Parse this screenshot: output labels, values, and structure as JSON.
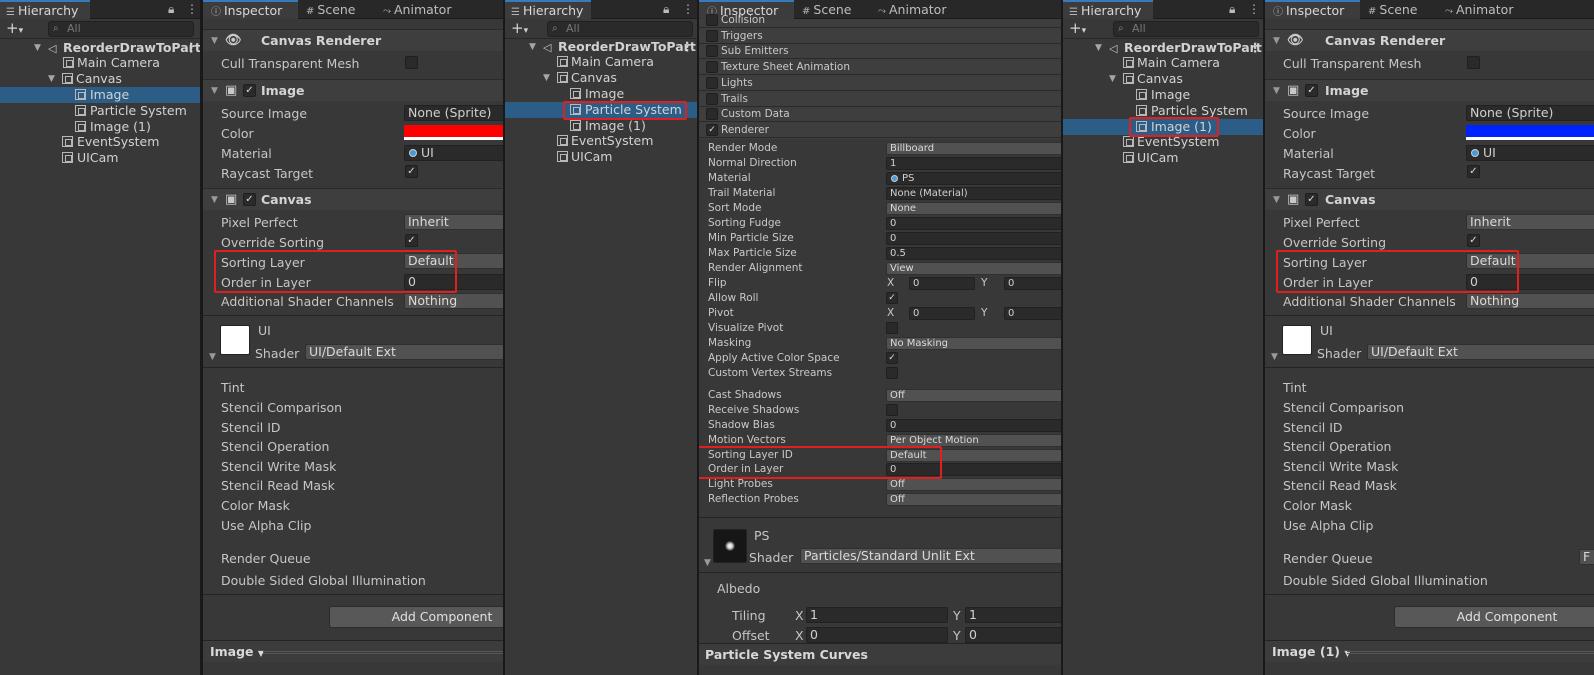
{
  "hierarchy": {
    "tab_label": "Hierarchy",
    "search_placeholder": "All",
    "scene_name": "ReorderDrawToPart",
    "items": [
      "Main Camera",
      "Canvas",
      "Image",
      "Particle System",
      "Image (1)",
      "EventSystem",
      "UICam"
    ]
  },
  "tabs": {
    "inspector": "Inspector",
    "scene": "Scene",
    "animator": "Animator"
  },
  "image_inspector": {
    "canvas_renderer": {
      "title": "Canvas Renderer",
      "cull_label": "Cull Transparent Mesh",
      "cull_checked": false
    },
    "image": {
      "title": "Image",
      "source_image_label": "Source Image",
      "source_image_value": "None (Sprite)",
      "color_label": "Color",
      "material_label": "Material",
      "material_value": "UI",
      "raycast_label": "Raycast Target",
      "raycast_checked": true
    },
    "canvas": {
      "title": "Canvas",
      "pixel_perfect_label": "Pixel Perfect",
      "pixel_perfect_value": "Inherit",
      "override_sorting_label": "Override Sorting",
      "override_sorting_checked": true,
      "sorting_layer_label": "Sorting Layer",
      "sorting_layer_value": "Default",
      "order_label": "Order in Layer",
      "order_value": "0",
      "shader_channels_label": "Additional Shader Channels",
      "shader_channels_value": "Nothing"
    },
    "material": {
      "name": "UI",
      "shader_label": "Shader",
      "shader_value": "UI/Default Ext",
      "props": [
        "Tint",
        "Stencil Comparison",
        "Stencil ID",
        "Stencil Operation",
        "Stencil Write Mask",
        "Stencil Read Mask",
        "Color Mask",
        "Use Alpha Clip"
      ],
      "render_queue_label": "Render Queue",
      "dsgi_label": "Double Sided Global Illumination",
      "render_queue_value_partial": "F"
    },
    "add_component": "Add Component"
  },
  "panel1": {
    "selected": "Image",
    "color": "#ff0000",
    "bottom_label": "Image"
  },
  "panel3": {
    "selected": "Image (1)",
    "color": "#0022ff",
    "bottom_label": "Image (1)"
  },
  "ps_inspector": {
    "modules": [
      {
        "label": "Collision",
        "checked": false
      },
      {
        "label": "Triggers",
        "checked": false
      },
      {
        "label": "Sub Emitters",
        "checked": false
      },
      {
        "label": "Texture Sheet Animation",
        "checked": false
      },
      {
        "label": "Lights",
        "checked": false
      },
      {
        "label": "Trails",
        "checked": false
      },
      {
        "label": "Custom Data",
        "checked": false
      },
      {
        "label": "Renderer",
        "checked": true
      }
    ],
    "renderer": {
      "render_mode_label": "Render Mode",
      "render_mode_value": "Billboard",
      "normal_dir_label": "Normal Direction",
      "normal_dir_value": "1",
      "material_label": "Material",
      "material_value": "PS",
      "trail_material_label": "Trail Material",
      "trail_material_value": "None (Material)",
      "sort_mode_label": "Sort Mode",
      "sort_mode_value": "None",
      "sorting_fudge_label": "Sorting Fudge",
      "sorting_fudge_value": "0",
      "min_size_label": "Min Particle Size",
      "min_size_value": "0",
      "max_size_label": "Max Particle Size",
      "max_size_value": "0.5",
      "alignment_label": "Render Alignment",
      "alignment_value": "View",
      "flip_label": "Flip",
      "flip_x": "0",
      "flip_y": "0",
      "allow_roll_label": "Allow Roll",
      "allow_roll_checked": true,
      "pivot_label": "Pivot",
      "pivot_x": "0",
      "pivot_y": "0",
      "vis_pivot_label": "Visualize Pivot",
      "vis_pivot_checked": false,
      "masking_label": "Masking",
      "masking_value": "No Masking",
      "active_color_label": "Apply Active Color Space",
      "active_color_checked": true,
      "custom_streams_label": "Custom Vertex Streams",
      "custom_streams_checked": false,
      "cast_shadows_label": "Cast Shadows",
      "cast_shadows_value": "Off",
      "receive_shadows_label": "Receive Shadows",
      "receive_shadows_checked": false,
      "shadow_bias_label": "Shadow Bias",
      "shadow_bias_value": "0",
      "motion_vectors_label": "Motion Vectors",
      "motion_vectors_value": "Per Object Motion",
      "sorting_layer_id_label": "Sorting Layer ID",
      "sorting_layer_id_value": "Default",
      "order_label": "Order in Layer",
      "order_value": "0",
      "light_probes_label": "Light Probes",
      "light_probes_value": "Off",
      "reflection_probes_label": "Reflection Probes",
      "reflection_probes_value": "Off"
    },
    "material": {
      "name": "PS",
      "shader_label": "Shader",
      "shader_value": "Particles/Standard Unlit Ext",
      "albedo_label": "Albedo",
      "tiling_label": "Tiling",
      "tiling_x": "1",
      "tiling_y": "1",
      "offset_label": "Offset",
      "offset_x": "0",
      "offset_y": "0"
    },
    "curves_label": "Particle System Curves",
    "axis_x": "X",
    "axis_y": "Y"
  }
}
